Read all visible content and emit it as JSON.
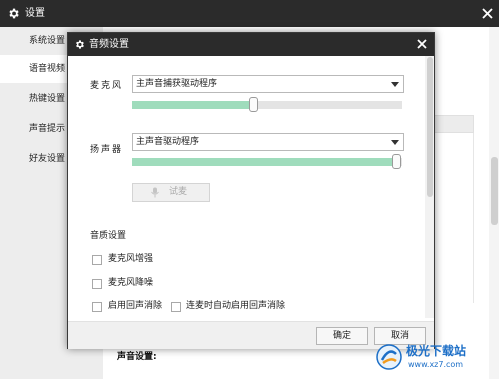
{
  "main_window": {
    "title": "设置",
    "sidebar": {
      "items": [
        {
          "label": "系统设置"
        },
        {
          "label": "语音视频"
        },
        {
          "label": "热键设置"
        },
        {
          "label": "声音提示"
        },
        {
          "label": "好友设置"
        }
      ],
      "active_index": 1
    },
    "background_section_label": "声音设置:"
  },
  "dialog": {
    "title": "音频设置",
    "microphone": {
      "label": "麦克风",
      "selected_device": "主声音捕获驱动程序",
      "volume_fraction": 0.45
    },
    "speaker": {
      "label": "扬声器",
      "selected_device": "主声音驱动程序",
      "volume_fraction": 0.98
    },
    "test_button": {
      "label": "试麦",
      "disabled": true
    },
    "quality": {
      "heading": "音质设置",
      "options": [
        {
          "label": "麦克风增强",
          "checked": false
        },
        {
          "label": "麦克风降噪",
          "checked": false
        },
        {
          "label": "启用回声消除",
          "checked": false
        },
        {
          "label": "连麦时自动启用回声消除",
          "checked": false
        }
      ]
    },
    "buttons": {
      "ok": "确定",
      "cancel": "取消"
    }
  },
  "watermark": {
    "brand": "极光下载站",
    "url": "www.xz7.com"
  },
  "colors": {
    "titlebar": "#2b2b2b",
    "slider_fill": "#9fdcbc",
    "sidebar_bg": "#ededed",
    "watermark_blue": "#1d6fc7"
  }
}
